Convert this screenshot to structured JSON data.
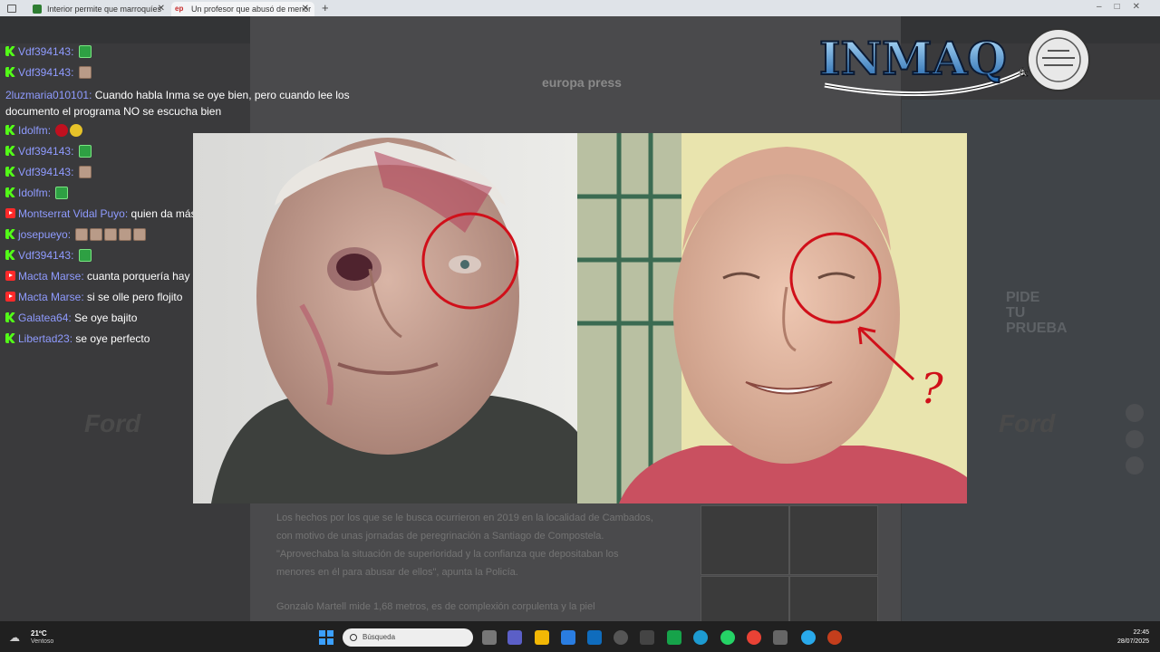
{
  "browser": {
    "tabs": [
      {
        "label": "Interior permite que marroquíes",
        "favicon_color": "#2e7d32"
      },
      {
        "label": "Un profesor que abusó de menor",
        "favicon_color": "#c62828",
        "favicon_text": "ep"
      }
    ],
    "new_tab": "+"
  },
  "page": {
    "site_name": "europa press",
    "article_paragraphs": [
      "Los hechos por los que se le busca ocurrieron en 2019 en la localidad de Cambados, con motivo de unas jornadas de peregrinación a Santiago de Compostela. \"Aprovechaba la situación de superioridad y la confianza que depositaban los menores en él para abusar de ellos\", apunta la Policía.",
      "Gonzalo Martell mide 1,68 metros, es de complexión corpulenta y la piel"
    ],
    "ad_text": "PIDE TU PRUEBA",
    "brand_text": "Ford"
  },
  "overlay_logo": "INMAQ",
  "chat": [
    {
      "platform": "kick",
      "user": "Vdf394143",
      "text": "",
      "emotes": [
        "green"
      ]
    },
    {
      "platform": "kick",
      "user": "Vdf394143",
      "text": "",
      "emotes": [
        "face"
      ]
    },
    {
      "platform": "kick",
      "user": "2luzmaria010101",
      "text": "Cuando habla Inma se oye bien, pero cuando lee los documento el programa NO se escucha bien",
      "emotes": []
    },
    {
      "platform": "kick",
      "user": "Idolfm",
      "text": "",
      "emotes": [
        "red",
        "yellow"
      ]
    },
    {
      "platform": "kick",
      "user": "Vdf394143",
      "text": "",
      "emotes": [
        "green"
      ]
    },
    {
      "platform": "kick",
      "user": "Vdf394143",
      "text": "",
      "emotes": [
        "face"
      ]
    },
    {
      "platform": "kick",
      "user": "Idolfm",
      "text": "",
      "emotes": [
        "green"
      ]
    },
    {
      "platform": "youtube",
      "user": "Montserrat Vidal Puyo",
      "text": "quien da más señoría en España todo vale",
      "emotes": []
    },
    {
      "platform": "kick",
      "user": "josepueyo",
      "text": "",
      "emotes": [
        "face",
        "face",
        "face",
        "face",
        "face"
      ]
    },
    {
      "platform": "kick",
      "user": "Vdf394143",
      "text": "",
      "emotes": [
        "green"
      ]
    },
    {
      "platform": "youtube",
      "user": "Macta Marse",
      "text": "cuanta porquería hay ufffff",
      "emotes": []
    },
    {
      "platform": "youtube",
      "user": "Macta Marse",
      "text": "si se olle pero flojito",
      "emotes": []
    },
    {
      "platform": "kick",
      "user": "Galatea64",
      "text": "Se oye bajito",
      "emotes": []
    },
    {
      "platform": "kick",
      "user": "Libertad23",
      "text": "se oye perfecto",
      "emotes": []
    }
  ],
  "photo": {
    "annotation_mark": "?",
    "circle_color": "#d0101a"
  },
  "taskbar": {
    "weather_temp": "21ºC",
    "weather_desc": "Ventoso",
    "search_placeholder": "Búsqueda",
    "time": "22:45",
    "date": "28/07/2025"
  }
}
